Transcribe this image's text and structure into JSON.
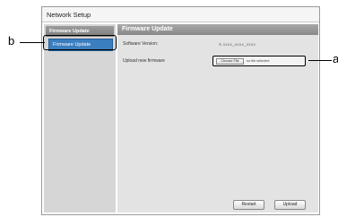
{
  "window": {
    "title": "Network Setup"
  },
  "sidebar": {
    "header": "Firmware Update",
    "items": [
      {
        "label": "Firmware Update",
        "selected": true
      }
    ]
  },
  "main": {
    "header": "Firmware Update",
    "software_version_label": "Software Version:",
    "software_version_value": "X.xxxx_xxxx_xxxx",
    "upload_label": "Upload new firmware",
    "choose_file_label": "Choose File",
    "no_file_text": "no file selected"
  },
  "buttons": {
    "restart": "Restart",
    "upload": "Upload"
  },
  "callouts": {
    "a": "a",
    "b": "b"
  },
  "colors": {
    "selected_item": "#3a7ec0",
    "header_gray": "#9c9c9c",
    "panel_bg": "#e3e3e3"
  }
}
